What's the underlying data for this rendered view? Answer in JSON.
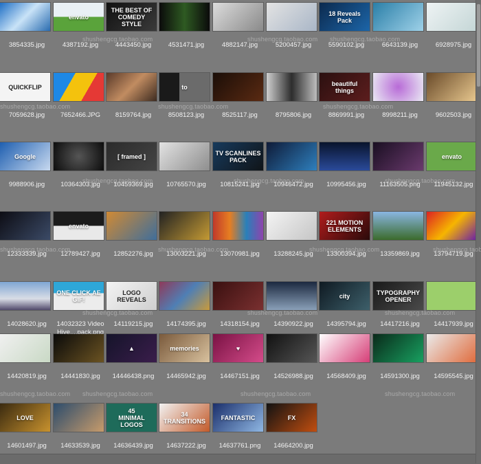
{
  "browser": {
    "watermark": "shushengcg.taobao.com",
    "items": [
      {
        "name": "3854335.jpg",
        "bg": "linear-gradient(135deg,#1f6fc5,#c9e3f7,#2a6cb0)",
        "text": ""
      },
      {
        "name": "4387192.jpg",
        "bg": "linear-gradient(180deg,#e9f0f5 50%,#5aa33b 50%)",
        "text": "envato"
      },
      {
        "name": "4443450.jpg",
        "bg": "linear-gradient(135deg,#111,#3a3a3a)",
        "text": "THE BEST OF\nCOMEDY STYLE"
      },
      {
        "name": "4531471.jpg",
        "bg": "linear-gradient(90deg,#0b0b0b,#2e5a22,#0b0b0b)",
        "text": ""
      },
      {
        "name": "4882147.jpg",
        "bg": "linear-gradient(135deg,#dcdcdc,#8a8a8a)",
        "text": ""
      },
      {
        "name": "5200457.jpg",
        "bg": "linear-gradient(135deg,#e3e3e3,#a9b6c7)",
        "text": ""
      },
      {
        "name": "5590102.jpg",
        "bg": "linear-gradient(135deg,#0c2a4e,#1c65a8)",
        "text": "18 Reveals Pack"
      },
      {
        "name": "6643139.jpg",
        "bg": "linear-gradient(135deg,#2b7fa8,#9ed1e8)",
        "text": ""
      },
      {
        "name": "6928975.jpg",
        "bg": "linear-gradient(135deg,#eef3f4,#c4d6d6)",
        "text": ""
      },
      {
        "name": "7059628.jpg",
        "bg": "#f4f4f4",
        "text": "QUICKFLIP",
        "dark": true
      },
      {
        "name": "7652466.JPG",
        "bg": "linear-gradient(120deg,#1e88e5 0 33%,#f4c20d 33% 66%,#e53935 66%)",
        "text": ""
      },
      {
        "name": "8159764.jpg",
        "bg": "linear-gradient(135deg,#5a3a2a,#c18c61,#3d2b20)",
        "text": ""
      },
      {
        "name": "8508123.jpg",
        "bg": "linear-gradient(90deg,#1a1a1a 40%,#6b6b6b 40%)",
        "text": "to"
      },
      {
        "name": "8525117.jpg",
        "bg": "linear-gradient(135deg,#1b0e08,#5a2a12)",
        "text": ""
      },
      {
        "name": "8795806.jpg",
        "bg": "linear-gradient(90deg,#cfcfcf,#2d2d2d,#bdbdbd)",
        "text": ""
      },
      {
        "name": "8869991.jpg",
        "bg": "linear-gradient(135deg,#2b1010,#5c1d1d)",
        "text": "beautiful\nthings"
      },
      {
        "name": "8998211.jpg",
        "bg": "radial-gradient(circle,#b86bd7,#e9e9f3)",
        "text": ""
      },
      {
        "name": "9602503.jpg",
        "bg": "linear-gradient(135deg,#6a4b2a,#e8c88f)",
        "text": ""
      },
      {
        "name": "9988906.jpg",
        "bg": "linear-gradient(135deg,#1f5fb0,#c8d9ef)",
        "text": "Google"
      },
      {
        "name": "10364303.jpg",
        "bg": "radial-gradient(circle,#555,#0c0c0c)",
        "text": ""
      },
      {
        "name": "10459369.jpg",
        "bg": "linear-gradient(135deg,#2b2b2b,#444)",
        "text": "[ framed ]"
      },
      {
        "name": "10765570.jpg",
        "bg": "linear-gradient(135deg,#e2e2e2,#8e8e8e)",
        "text": ""
      },
      {
        "name": "10815241.jpg",
        "bg": "linear-gradient(135deg,#173a5c,#101418)",
        "text": "TV SCANLINES\nPACK"
      },
      {
        "name": "10946472.jpg",
        "bg": "linear-gradient(135deg,#0f1b38,#2e7fbd)",
        "text": ""
      },
      {
        "name": "10995456.jpg",
        "bg": "linear-gradient(180deg,#09142c,#2a4a9a)",
        "text": ""
      },
      {
        "name": "11163505.png",
        "bg": "linear-gradient(135deg,#1a0f22,#6a3a6d)",
        "text": ""
      },
      {
        "name": "11945132.jpg",
        "bg": "#6aa94a",
        "text": "envato"
      },
      {
        "name": "12333339.jpg",
        "bg": "linear-gradient(135deg,#0d0d14,#3b4a66)",
        "text": ""
      },
      {
        "name": "12789427.jpg",
        "bg": "linear-gradient(180deg,#1b1b1b 50%,#e9e9e9 50%)",
        "text": "envato"
      },
      {
        "name": "12852276.jpg",
        "bg": "linear-gradient(135deg,#d08a34,#3f6e9b)",
        "text": ""
      },
      {
        "name": "13003221.jpg",
        "bg": "linear-gradient(135deg,#222,#c49a34)",
        "text": ""
      },
      {
        "name": "13070981.jpg",
        "bg": "linear-gradient(90deg,#c0392b,#e67e22,#2980b9,#8e44ad)",
        "text": ""
      },
      {
        "name": "13288245.jpg",
        "bg": "linear-gradient(135deg,#f4f4f4,#c5c5c5)",
        "text": ""
      },
      {
        "name": "13300394.jpg",
        "bg": "linear-gradient(135deg,#b01c1c,#2a0a0a)",
        "text": "221 MOTION\nELEMENTS"
      },
      {
        "name": "13359869.jpg",
        "bg": "linear-gradient(180deg,#8ab6e2,#3b6b2c)",
        "text": ""
      },
      {
        "name": "13794719.jpg",
        "bg": "linear-gradient(135deg,#d22,#f6b500,#6a1fa8)",
        "text": ""
      },
      {
        "name": "14028620.jpg",
        "bg": "linear-gradient(180deg,#7fa6d3,#d9dde6 60%,#514a6b)",
        "text": ""
      },
      {
        "name": "14032323 Video Hive....pack.png",
        "bg": "linear-gradient(180deg,#2ea7d8 40%,#ececec 40%)",
        "text": "ONE CLICK AE GIF!"
      },
      {
        "name": "14119215.jpg",
        "bg": "linear-gradient(135deg,#f3f3f3,#cfcfcf)",
        "text": "LOGO\nREVEALS",
        "dark": true
      },
      {
        "name": "14174395.jpg",
        "bg": "linear-gradient(135deg,#8e3a5a,#4f7fb5,#c89a3c)",
        "text": ""
      },
      {
        "name": "14318154.jpg",
        "bg": "linear-gradient(135deg,#3a1010,#7a3030)",
        "text": ""
      },
      {
        "name": "14390922.jpg",
        "bg": "linear-gradient(180deg,#1c2940,#8aa0b8)",
        "text": ""
      },
      {
        "name": "14395794.jpg",
        "bg": "linear-gradient(135deg,#0f1a22,#3d5f6a)",
        "text": "city"
      },
      {
        "name": "14417216.jpg",
        "bg": "linear-gradient(135deg,#1a1a1a,#4a4a4a)",
        "text": "TYPOGRAPHY\nOPENER"
      },
      {
        "name": "14417939.jpg",
        "bg": "#9ccf6b",
        "text": ""
      },
      {
        "name": "14420819.jpg",
        "bg": "linear-gradient(135deg,#f0f0f0,#c9d9c5)",
        "text": ""
      },
      {
        "name": "14441830.jpg",
        "bg": "linear-gradient(135deg,#0a0a0a,#6b5322)",
        "text": ""
      },
      {
        "name": "14446438.png",
        "bg": "linear-gradient(135deg,#15142a,#3a1d4b)",
        "text": "▲"
      },
      {
        "name": "14465942.jpg",
        "bg": "linear-gradient(135deg,#7a5a3c,#d8c19e)",
        "text": "memories"
      },
      {
        "name": "14467151.jpg",
        "bg": "linear-gradient(135deg,#7a1244,#d44c8a)",
        "text": "♥"
      },
      {
        "name": "14526988.jpg",
        "bg": "linear-gradient(135deg,#111,#555)",
        "text": ""
      },
      {
        "name": "14568409.jpg",
        "bg": "linear-gradient(135deg,#ffffff,#d63e77)",
        "text": ""
      },
      {
        "name": "14591300.jpg",
        "bg": "linear-gradient(135deg,#0a2a1a,#18a060)",
        "text": ""
      },
      {
        "name": "14595545.jpg",
        "bg": "linear-gradient(135deg,#eaeaea,#e06b3c)",
        "text": ""
      },
      {
        "name": "14601497.jpg",
        "bg": "linear-gradient(135deg,#3a2a10,#c8922e)",
        "text": "LOVE"
      },
      {
        "name": "14633539.jpg",
        "bg": "linear-gradient(135deg,#2c4c6c,#c79b6b)",
        "text": ""
      },
      {
        "name": "14636439.jpg",
        "bg": "#1e6b5a",
        "text": "45\nMINIMAL\nLOGOS"
      },
      {
        "name": "14637222.jpg",
        "bg": "linear-gradient(135deg,#f2f2f2,#c35a2a)",
        "text": "34 TRANSITIONS"
      },
      {
        "name": "14637761.png",
        "bg": "linear-gradient(135deg,#1b2f6b,#8fb7e3)",
        "text": "FANTASTIC"
      },
      {
        "name": "14664200.jpg",
        "bg": "linear-gradient(135deg,#121212,#c14e10)",
        "text": "FX"
      }
    ]
  }
}
